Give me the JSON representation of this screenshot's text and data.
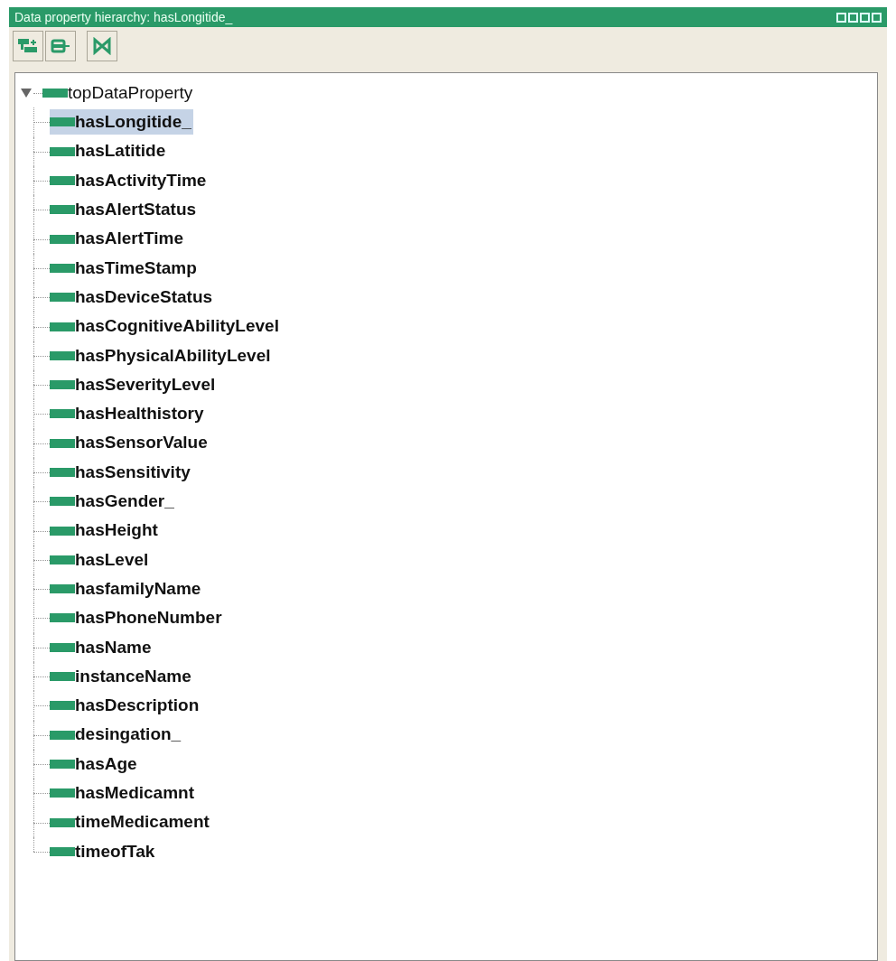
{
  "window": {
    "title": "Data property hierarchy: hasLongitide_"
  },
  "toolbar": {
    "buttons": [
      {
        "kind": "add-sub"
      },
      {
        "kind": "add-sibling"
      },
      {
        "kind": "delete"
      }
    ]
  },
  "tree": [
    {
      "label": "topDataProperty",
      "expanded": true,
      "selected": false,
      "children": [
        {
          "label": "hasLongitide_",
          "selected": true
        },
        {
          "label": "hasLatitide",
          "selected": false
        },
        {
          "label": "hasActivityTime",
          "selected": false
        },
        {
          "label": "hasAlertStatus",
          "selected": false
        },
        {
          "label": "hasAlertTime",
          "selected": false
        },
        {
          "label": "hasTimeStamp",
          "selected": false
        },
        {
          "label": "hasDeviceStatus",
          "selected": false
        },
        {
          "label": "hasCognitiveAbilityLevel",
          "selected": false
        },
        {
          "label": "hasPhysicalAbilityLevel",
          "selected": false
        },
        {
          "label": "hasSeverityLevel",
          "selected": false
        },
        {
          "label": "hasHealthistory",
          "selected": false
        },
        {
          "label": "hasSensorValue",
          "selected": false
        },
        {
          "label": "hasSensitivity",
          "selected": false
        },
        {
          "label": "hasGender_",
          "selected": false
        },
        {
          "label": "hasHeight",
          "selected": false
        },
        {
          "label": "hasLevel",
          "selected": false
        },
        {
          "label": "hasfamilyName",
          "selected": false
        },
        {
          "label": "hasPhoneNumber",
          "selected": false
        },
        {
          "label": "hasName",
          "selected": false
        },
        {
          "label": "instanceName",
          "selected": false
        },
        {
          "label": "hasDescription",
          "selected": false
        },
        {
          "label": "desingation_",
          "selected": false
        },
        {
          "label": "hasAge",
          "selected": false
        },
        {
          "label": "hasMedicamnt",
          "selected": false
        },
        {
          "label": "timeMedicament",
          "selected": false
        },
        {
          "label": "timeofTak",
          "selected": false
        }
      ]
    }
  ]
}
